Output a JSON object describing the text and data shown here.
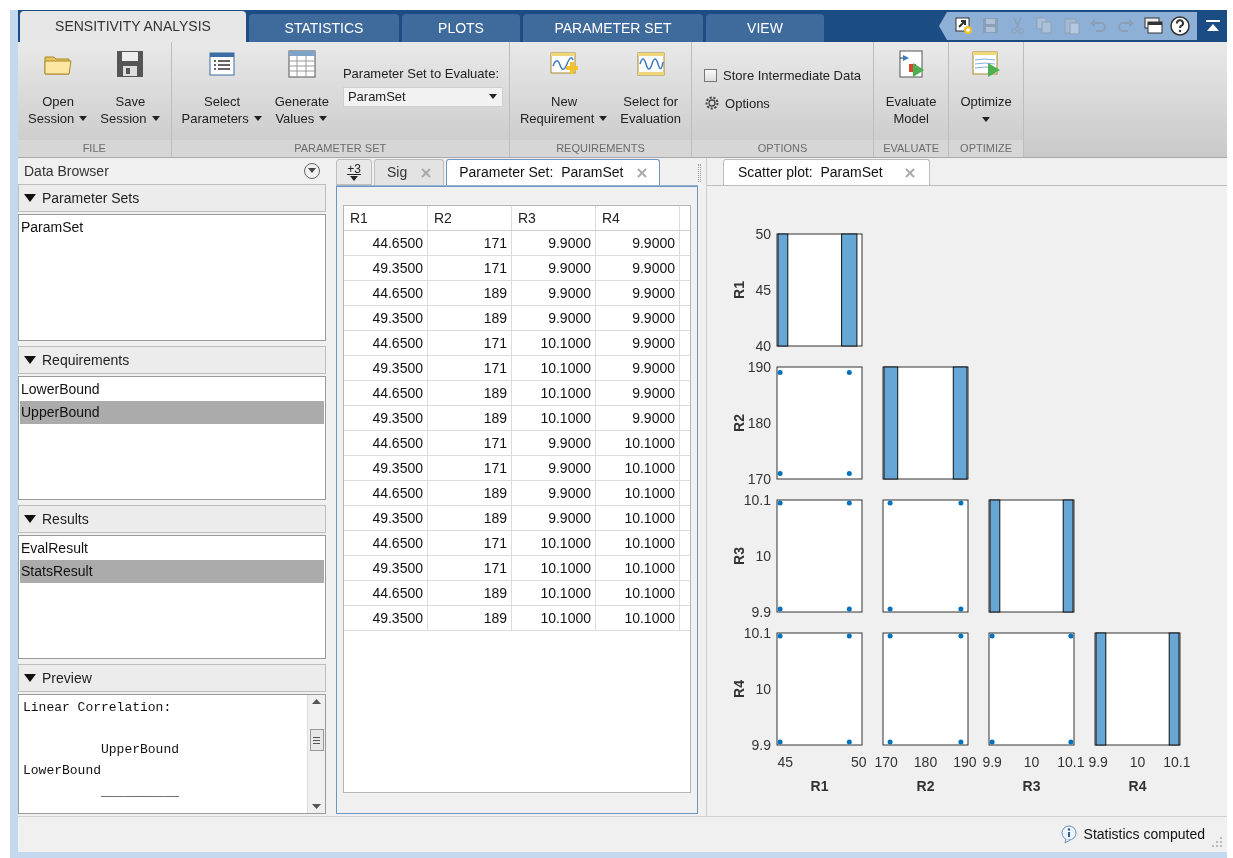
{
  "toolstrip": {
    "tabs": [
      {
        "label": "SENSITIVITY ANALYSIS",
        "selected": true
      },
      {
        "label": "STATISTICS",
        "selected": false
      },
      {
        "label": "PLOTS",
        "selected": false
      },
      {
        "label": "PARAMETER SET",
        "selected": false
      },
      {
        "label": "VIEW",
        "selected": false
      }
    ],
    "quick_access": [
      {
        "disabled": false
      },
      {
        "disabled": true
      },
      {
        "disabled": true
      },
      {
        "disabled": true
      },
      {
        "disabled": true
      },
      {
        "disabled": true
      },
      {
        "disabled": true
      },
      {
        "disabled": false
      },
      {
        "disabled": false
      }
    ]
  },
  "ribbon": {
    "groups": [
      {
        "title": "FILE",
        "items": [
          {
            "kind": "button",
            "lines": [
              "Open",
              "Session"
            ],
            "dropdown": true
          },
          {
            "kind": "button",
            "lines": [
              "Save",
              "Session"
            ],
            "dropdown": true
          }
        ]
      },
      {
        "title": "PARAMETER SET",
        "items": [
          {
            "kind": "button",
            "lines": [
              "Select",
              "Parameters"
            ],
            "dropdown": true
          },
          {
            "kind": "button",
            "lines": [
              "Generate",
              "Values"
            ],
            "dropdown": true
          },
          {
            "kind": "combo",
            "label": "Parameter Set to Evaluate:",
            "value": "ParamSet"
          }
        ]
      },
      {
        "title": "REQUIREMENTS",
        "items": [
          {
            "kind": "button",
            "lines": [
              "New",
              "Requirement"
            ],
            "dropdown": true
          },
          {
            "kind": "button",
            "lines": [
              "Select for",
              "Evaluation"
            ],
            "dropdown": false
          }
        ]
      },
      {
        "title": "OPTIONS",
        "items": [
          {
            "kind": "checkbox",
            "label": "Store Intermediate Data",
            "checked": false
          },
          {
            "kind": "gear",
            "label": "Options"
          }
        ]
      },
      {
        "title": "EVALUATE",
        "items": [
          {
            "kind": "button",
            "lines": [
              "Evaluate",
              "Model"
            ],
            "dropdown": false
          }
        ]
      },
      {
        "title": "OPTIMIZE",
        "items": [
          {
            "kind": "button",
            "lines": [
              "Optimize"
            ],
            "dropdown": true
          }
        ]
      }
    ]
  },
  "data_browser": {
    "title": "Data Browser",
    "sections": [
      {
        "title": "Parameter Sets",
        "expanded": true,
        "items": [
          {
            "label": "ParamSet",
            "selected": false
          }
        ]
      },
      {
        "title": "Requirements",
        "expanded": true,
        "items": [
          {
            "label": "LowerBound",
            "selected": false
          },
          {
            "label": "UpperBound",
            "selected": true
          }
        ]
      },
      {
        "title": "Results",
        "expanded": true,
        "items": [
          {
            "label": "EvalResult",
            "selected": false
          },
          {
            "label": "StatsResult",
            "selected": true
          }
        ]
      }
    ],
    "preview": {
      "title": "Preview",
      "expanded": true,
      "text": "Linear Correlation:\n\n          UpperBound\nLowerBound\n          __________"
    }
  },
  "documents": {
    "overflow": "+3",
    "tabs": [
      {
        "label": "Sig",
        "selected": false
      },
      {
        "label": "Parameter Set:  ParamSet",
        "selected": true
      }
    ]
  },
  "table": {
    "columns": [
      "R1",
      "R2",
      "R3",
      "R4"
    ],
    "rows": [
      [
        "44.6500",
        "171",
        "9.9000",
        "9.9000"
      ],
      [
        "49.3500",
        "171",
        "9.9000",
        "9.9000"
      ],
      [
        "44.6500",
        "189",
        "9.9000",
        "9.9000"
      ],
      [
        "49.3500",
        "189",
        "9.9000",
        "9.9000"
      ],
      [
        "44.6500",
        "171",
        "10.1000",
        "9.9000"
      ],
      [
        "49.3500",
        "171",
        "10.1000",
        "9.9000"
      ],
      [
        "44.6500",
        "189",
        "10.1000",
        "9.9000"
      ],
      [
        "49.3500",
        "189",
        "10.1000",
        "9.9000"
      ],
      [
        "44.6500",
        "171",
        "9.9000",
        "10.1000"
      ],
      [
        "49.3500",
        "171",
        "9.9000",
        "10.1000"
      ],
      [
        "44.6500",
        "189",
        "9.9000",
        "10.1000"
      ],
      [
        "49.3500",
        "189",
        "9.9000",
        "10.1000"
      ],
      [
        "44.6500",
        "171",
        "10.1000",
        "10.1000"
      ],
      [
        "49.3500",
        "171",
        "10.1000",
        "10.1000"
      ],
      [
        "44.6500",
        "189",
        "10.1000",
        "10.1000"
      ],
      [
        "49.3500",
        "189",
        "10.1000",
        "10.1000"
      ]
    ]
  },
  "plot": {
    "tab": {
      "label": "Scatter plot:  ParamSet",
      "selected": true
    },
    "scatter_matrix": {
      "variables": [
        {
          "y_label": "R1",
          "y_ticks": [
            "50",
            "45",
            "40"
          ],
          "x_ticks": [
            "45",
            "50"
          ],
          "x_label": "R1"
        },
        {
          "y_label": "R2",
          "y_ticks": [
            "190",
            "180",
            "170"
          ],
          "x_ticks": [
            "170",
            "180",
            "190"
          ],
          "x_label": "R2"
        },
        {
          "y_label": "R3",
          "y_ticks": [
            "10.1",
            "10",
            "9.9"
          ],
          "x_ticks": [
            "9.9",
            "10",
            "10.1"
          ],
          "x_label": "R3"
        },
        {
          "y_label": "R4",
          "y_ticks": [
            "10.1",
            "10",
            "9.9"
          ],
          "x_ticks": [
            "9.9",
            "10",
            "10.1"
          ],
          "x_label": "R4"
        }
      ]
    }
  },
  "status_bar": {
    "message": "Statistics computed"
  }
}
